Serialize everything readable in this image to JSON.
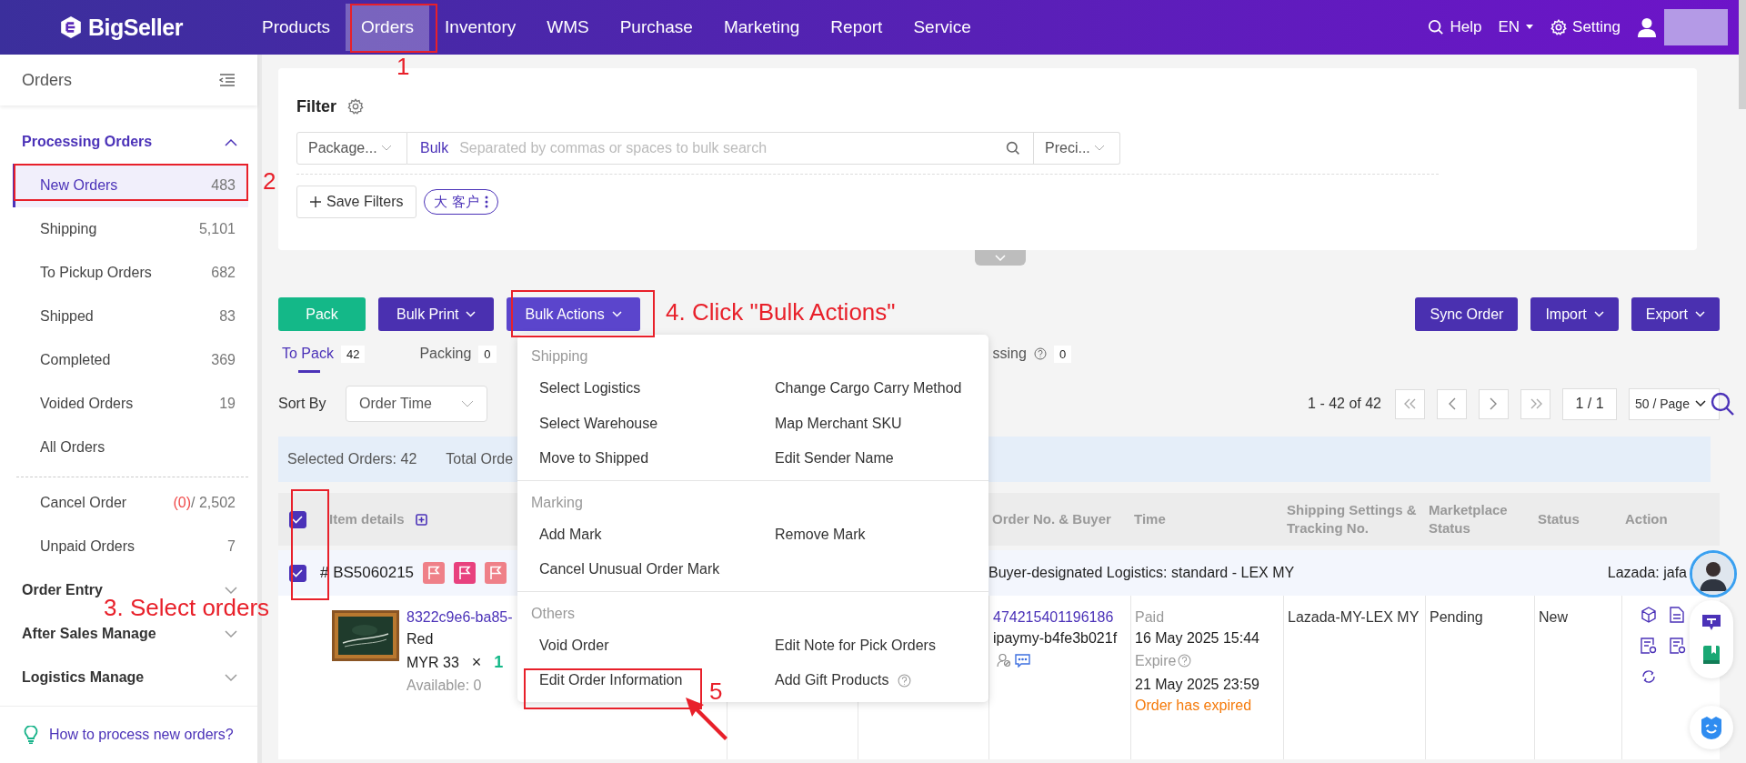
{
  "top_nav": {
    "logo": "BigSeller",
    "items": [
      {
        "label": "Products",
        "selected": false
      },
      {
        "label": "Orders",
        "selected": true
      },
      {
        "label": "Inventory",
        "selected": false
      },
      {
        "label": "WMS",
        "selected": false
      },
      {
        "label": "Purchase",
        "selected": false
      },
      {
        "label": "Marketing",
        "selected": false
      },
      {
        "label": "Report",
        "selected": false
      },
      {
        "label": "Service",
        "selected": false
      }
    ],
    "help": "Help",
    "language": "EN",
    "setting": "Setting"
  },
  "sidebar": {
    "title": "Orders",
    "groups": [
      {
        "label": "Processing Orders",
        "expanded": true,
        "children": [
          {
            "label": "New Orders",
            "count": "483",
            "selected": true
          },
          {
            "label": "Shipping",
            "count": "5,101",
            "selected": false
          },
          {
            "label": "To Pickup Orders",
            "count": "682",
            "selected": false
          },
          {
            "label": "Shipped",
            "count": "83",
            "selected": false
          },
          {
            "label": "Completed",
            "count": "369",
            "selected": false
          },
          {
            "label": "Voided Orders",
            "count": "19",
            "selected": false
          },
          {
            "label": "All Orders",
            "selected": false
          }
        ],
        "more_children": [
          {
            "label": "Cancel Order",
            "alert_count": "(0)",
            "count": "/ 2,502",
            "selected": false
          },
          {
            "label": "Unpaid Orders",
            "count": "7",
            "selected": false
          }
        ]
      },
      {
        "label": "Order Entry",
        "expanded": false
      },
      {
        "label": "After Sales Manage",
        "expanded": false
      },
      {
        "label": "Logistics Manage",
        "expanded": false
      }
    ],
    "footer_link": "How to process new orders?"
  },
  "filter": {
    "title": "Filter",
    "field_select": "Package...",
    "bulk_label": "Bulk",
    "search_placeholder": "Separated by commas or spaces to bulk search",
    "match_select": "Preci...",
    "save_button": "Save Filters",
    "saved_tags": [
      "大 客户"
    ]
  },
  "toolbar": {
    "left_buttons": [
      {
        "label": "Pack",
        "kind": "green",
        "open": false
      },
      {
        "label": "Bulk Print",
        "kind": "menu",
        "open": false
      },
      {
        "label": "Bulk Actions",
        "kind": "menu",
        "open": true
      }
    ],
    "right_buttons": [
      {
        "label": "Sync Order",
        "kind": "plain",
        "open": false
      },
      {
        "label": "Import",
        "kind": "menu",
        "open": false
      },
      {
        "label": "Export",
        "kind": "menu",
        "open": false
      }
    ]
  },
  "status_tabs": [
    {
      "label": "To Pack",
      "count": "42",
      "selected": true,
      "help": false
    },
    {
      "label": "Packing",
      "count": "0",
      "selected": false,
      "help": false
    },
    {
      "label": "ssing",
      "count": "0",
      "selected": false,
      "help": true
    }
  ],
  "sort": {
    "label": "Sort By",
    "value": "Order Time"
  },
  "pagination": {
    "range": "1 - 42 of 42",
    "page": "1 / 1",
    "page_size": "50 / Page"
  },
  "summary": {
    "selected": "Selected Orders: 42",
    "total": "Total Orde"
  },
  "table": {
    "header_checked": true,
    "columns": [
      "Item details",
      "Order No. & Buyer",
      "Time",
      "Shipping Settings & Tracking No.",
      "Marketplace Status",
      "Status",
      "Action"
    ],
    "orders": [
      {
        "checked": true,
        "number": "# BS5060215",
        "flags": [
          {
            "color": "#ef8088"
          },
          {
            "color": "#e8417e"
          },
          {
            "color": "#ef8088"
          }
        ],
        "logistics": "Buyer-designated Logistics: standard - LEX MY",
        "store": "Lazada: jafa",
        "item": {
          "sku": "8322c9e6-ba85-",
          "variant": "Red",
          "price": "MYR 33",
          "times": "×",
          "qty": "1",
          "available": "Available: 0"
        },
        "order_no": "474215401196186",
        "buyer": "ipaymy-b4fe3b021f",
        "time": {
          "paid_label": "Paid",
          "paid": "16 May 2025 15:44",
          "expire_label": "Expire",
          "expire": "21 May 2025 23:59",
          "note": "Order has expired"
        },
        "shipping": "Lazada-MY-LEX MY",
        "marketplace_status": "Pending",
        "status": "New"
      }
    ]
  },
  "bulk_menu": {
    "sections": [
      {
        "title": "Shipping",
        "items": [
          {
            "label": "Select Logistics",
            "help": false
          },
          {
            "label": "Change Cargo Carry Method",
            "help": false
          },
          {
            "label": "Select Warehouse",
            "help": false
          },
          {
            "label": "Map Merchant SKU",
            "help": false
          },
          {
            "label": "Move to Shipped",
            "help": false
          },
          {
            "label": "Edit Sender Name",
            "help": false
          }
        ]
      },
      {
        "title": "Marking",
        "items": [
          {
            "label": "Add Mark",
            "help": false
          },
          {
            "label": "Remove Mark",
            "help": false
          },
          {
            "label": "Cancel Unusual Order Mark",
            "help": false
          }
        ]
      },
      {
        "title": "Others",
        "items": [
          {
            "label": "Void Order",
            "help": false
          },
          {
            "label": "Edit Note for Pick Orders",
            "help": false
          },
          {
            "label": "Edit Order Information",
            "help": false
          },
          {
            "label": "Add Gift Products",
            "help": true
          }
        ]
      }
    ]
  },
  "annotations": [
    "1",
    "2",
    "3. Select orders",
    "4. Click \"Bulk Actions\"",
    "5"
  ]
}
